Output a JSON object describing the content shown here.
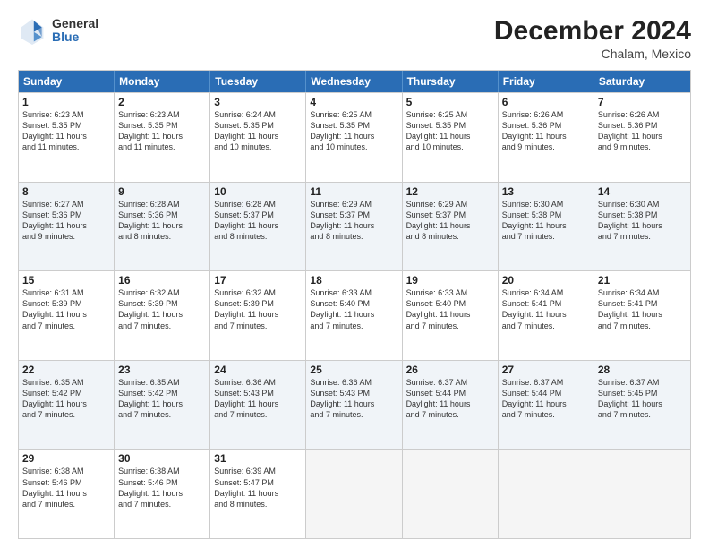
{
  "header": {
    "logo_general": "General",
    "logo_blue": "Blue",
    "month_title": "December 2024",
    "location": "Chalam, Mexico"
  },
  "calendar": {
    "days": [
      "Sunday",
      "Monday",
      "Tuesday",
      "Wednesday",
      "Thursday",
      "Friday",
      "Saturday"
    ],
    "rows": [
      [
        {
          "num": "1",
          "lines": [
            "Sunrise: 6:23 AM",
            "Sunset: 5:35 PM",
            "Daylight: 11 hours",
            "and 11 minutes."
          ]
        },
        {
          "num": "2",
          "lines": [
            "Sunrise: 6:23 AM",
            "Sunset: 5:35 PM",
            "Daylight: 11 hours",
            "and 11 minutes."
          ]
        },
        {
          "num": "3",
          "lines": [
            "Sunrise: 6:24 AM",
            "Sunset: 5:35 PM",
            "Daylight: 11 hours",
            "and 10 minutes."
          ]
        },
        {
          "num": "4",
          "lines": [
            "Sunrise: 6:25 AM",
            "Sunset: 5:35 PM",
            "Daylight: 11 hours",
            "and 10 minutes."
          ]
        },
        {
          "num": "5",
          "lines": [
            "Sunrise: 6:25 AM",
            "Sunset: 5:35 PM",
            "Daylight: 11 hours",
            "and 10 minutes."
          ]
        },
        {
          "num": "6",
          "lines": [
            "Sunrise: 6:26 AM",
            "Sunset: 5:36 PM",
            "Daylight: 11 hours",
            "and 9 minutes."
          ]
        },
        {
          "num": "7",
          "lines": [
            "Sunrise: 6:26 AM",
            "Sunset: 5:36 PM",
            "Daylight: 11 hours",
            "and 9 minutes."
          ]
        }
      ],
      [
        {
          "num": "8",
          "lines": [
            "Sunrise: 6:27 AM",
            "Sunset: 5:36 PM",
            "Daylight: 11 hours",
            "and 9 minutes."
          ]
        },
        {
          "num": "9",
          "lines": [
            "Sunrise: 6:28 AM",
            "Sunset: 5:36 PM",
            "Daylight: 11 hours",
            "and 8 minutes."
          ]
        },
        {
          "num": "10",
          "lines": [
            "Sunrise: 6:28 AM",
            "Sunset: 5:37 PM",
            "Daylight: 11 hours",
            "and 8 minutes."
          ]
        },
        {
          "num": "11",
          "lines": [
            "Sunrise: 6:29 AM",
            "Sunset: 5:37 PM",
            "Daylight: 11 hours",
            "and 8 minutes."
          ]
        },
        {
          "num": "12",
          "lines": [
            "Sunrise: 6:29 AM",
            "Sunset: 5:37 PM",
            "Daylight: 11 hours",
            "and 8 minutes."
          ]
        },
        {
          "num": "13",
          "lines": [
            "Sunrise: 6:30 AM",
            "Sunset: 5:38 PM",
            "Daylight: 11 hours",
            "and 7 minutes."
          ]
        },
        {
          "num": "14",
          "lines": [
            "Sunrise: 6:30 AM",
            "Sunset: 5:38 PM",
            "Daylight: 11 hours",
            "and 7 minutes."
          ]
        }
      ],
      [
        {
          "num": "15",
          "lines": [
            "Sunrise: 6:31 AM",
            "Sunset: 5:39 PM",
            "Daylight: 11 hours",
            "and 7 minutes."
          ]
        },
        {
          "num": "16",
          "lines": [
            "Sunrise: 6:32 AM",
            "Sunset: 5:39 PM",
            "Daylight: 11 hours",
            "and 7 minutes."
          ]
        },
        {
          "num": "17",
          "lines": [
            "Sunrise: 6:32 AM",
            "Sunset: 5:39 PM",
            "Daylight: 11 hours",
            "and 7 minutes."
          ]
        },
        {
          "num": "18",
          "lines": [
            "Sunrise: 6:33 AM",
            "Sunset: 5:40 PM",
            "Daylight: 11 hours",
            "and 7 minutes."
          ]
        },
        {
          "num": "19",
          "lines": [
            "Sunrise: 6:33 AM",
            "Sunset: 5:40 PM",
            "Daylight: 11 hours",
            "and 7 minutes."
          ]
        },
        {
          "num": "20",
          "lines": [
            "Sunrise: 6:34 AM",
            "Sunset: 5:41 PM",
            "Daylight: 11 hours",
            "and 7 minutes."
          ]
        },
        {
          "num": "21",
          "lines": [
            "Sunrise: 6:34 AM",
            "Sunset: 5:41 PM",
            "Daylight: 11 hours",
            "and 7 minutes."
          ]
        }
      ],
      [
        {
          "num": "22",
          "lines": [
            "Sunrise: 6:35 AM",
            "Sunset: 5:42 PM",
            "Daylight: 11 hours",
            "and 7 minutes."
          ]
        },
        {
          "num": "23",
          "lines": [
            "Sunrise: 6:35 AM",
            "Sunset: 5:42 PM",
            "Daylight: 11 hours",
            "and 7 minutes."
          ]
        },
        {
          "num": "24",
          "lines": [
            "Sunrise: 6:36 AM",
            "Sunset: 5:43 PM",
            "Daylight: 11 hours",
            "and 7 minutes."
          ]
        },
        {
          "num": "25",
          "lines": [
            "Sunrise: 6:36 AM",
            "Sunset: 5:43 PM",
            "Daylight: 11 hours",
            "and 7 minutes."
          ]
        },
        {
          "num": "26",
          "lines": [
            "Sunrise: 6:37 AM",
            "Sunset: 5:44 PM",
            "Daylight: 11 hours",
            "and 7 minutes."
          ]
        },
        {
          "num": "27",
          "lines": [
            "Sunrise: 6:37 AM",
            "Sunset: 5:44 PM",
            "Daylight: 11 hours",
            "and 7 minutes."
          ]
        },
        {
          "num": "28",
          "lines": [
            "Sunrise: 6:37 AM",
            "Sunset: 5:45 PM",
            "Daylight: 11 hours",
            "and 7 minutes."
          ]
        }
      ],
      [
        {
          "num": "29",
          "lines": [
            "Sunrise: 6:38 AM",
            "Sunset: 5:46 PM",
            "Daylight: 11 hours",
            "and 7 minutes."
          ]
        },
        {
          "num": "30",
          "lines": [
            "Sunrise: 6:38 AM",
            "Sunset: 5:46 PM",
            "Daylight: 11 hours",
            "and 7 minutes."
          ]
        },
        {
          "num": "31",
          "lines": [
            "Sunrise: 6:39 AM",
            "Sunset: 5:47 PM",
            "Daylight: 11 hours",
            "and 8 minutes."
          ]
        },
        {
          "num": "",
          "lines": []
        },
        {
          "num": "",
          "lines": []
        },
        {
          "num": "",
          "lines": []
        },
        {
          "num": "",
          "lines": []
        }
      ]
    ]
  }
}
